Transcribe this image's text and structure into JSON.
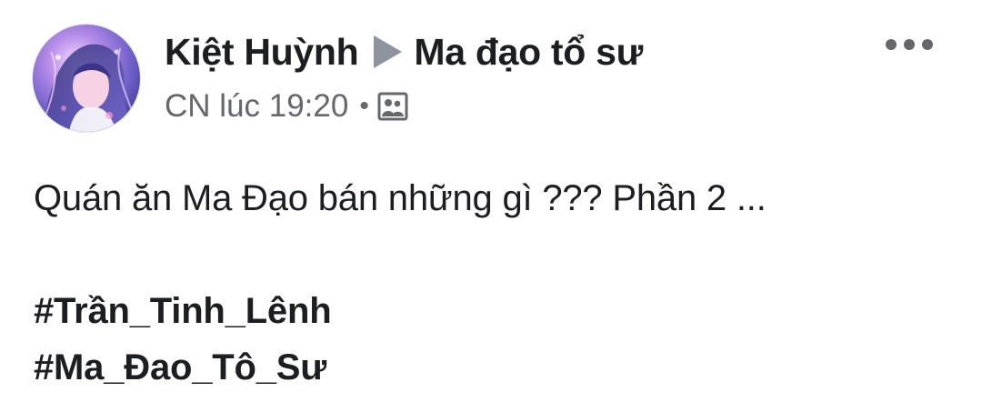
{
  "post": {
    "author": "Kiệt Huỳnh",
    "group": "Ma đạo tổ sư",
    "timestamp": "CN lúc 19:20",
    "separator": "•",
    "privacy_icon": "photo-audience-icon",
    "menu_icon": "more-options-icon",
    "text": "Quán ăn Ma Đạo bán những gì ??? Phần 2 ...",
    "hashtags": [
      "#Trần_Tinh_Lênh",
      "#Ma_Đao_Tô_Sư"
    ]
  },
  "colors": {
    "primary_text": "#1c1e21",
    "secondary_text": "#65676b",
    "arrow": "#8d949e",
    "background": "#ffffff"
  }
}
